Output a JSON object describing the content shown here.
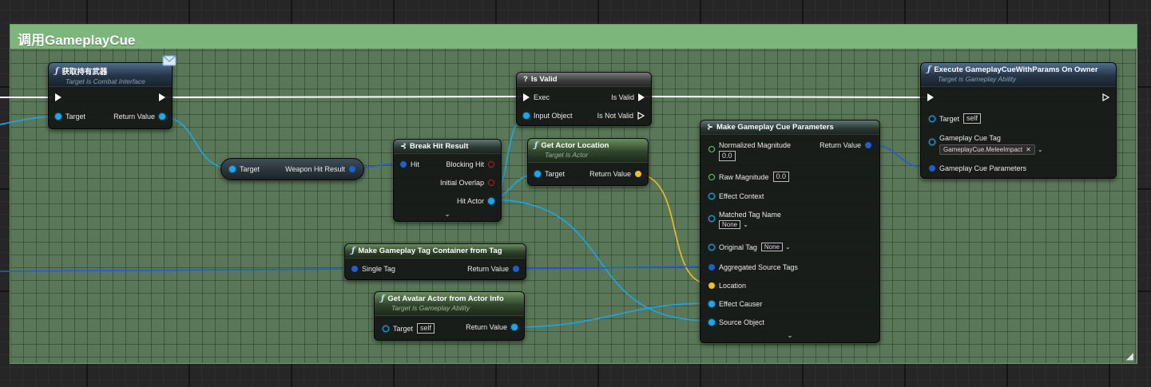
{
  "comment": {
    "title": "调用GameplayCue",
    "resize_glyph": "◢"
  },
  "colors": {
    "exec": "#ffffff",
    "object": "#1aa7ec",
    "struct": "#1d5ed7",
    "vector": "#f0be1f",
    "float": "#5fd35a",
    "bool": "#b31e1e"
  },
  "nodes": {
    "get_weapon": {
      "title": "获取持有武器",
      "subtitle": "Target is Combat Interface",
      "in_target": "Target",
      "out_return": "Return Value",
      "icon": "function-icon",
      "badge": "mail-icon"
    },
    "weapon_hit": {
      "in_target": "Target",
      "out": "Weapon Hit Result"
    },
    "break_hit": {
      "title": "Break Hit Result",
      "in_hit": "Hit",
      "out_blocking": "Blocking Hit",
      "out_overlap": "Initial Overlap",
      "out_actor": "Hit Actor"
    },
    "is_valid": {
      "title": "Is Valid",
      "in_exec": "Exec",
      "in_object": "Input Object",
      "out_valid": "Is Valid",
      "out_not_valid": "Is Not Valid"
    },
    "get_location": {
      "title": "Get Actor Location",
      "subtitle": "Target is Actor",
      "in_target": "Target",
      "out_return": "Return Value"
    },
    "make_container": {
      "title": "Make Gameplay Tag Container from Tag",
      "in_single": "Single Tag",
      "out_return": "Return Value"
    },
    "get_avatar": {
      "title": "Get Avatar Actor from Actor Info",
      "subtitle": "Target is Gameplay Ability",
      "in_target": "Target",
      "target_value": "self",
      "out_return": "Return Value"
    },
    "make_params": {
      "title": "Make Gameplay Cue Parameters",
      "normalized_magnitude": "Normalized Magnitude",
      "normalized_value": "0.0",
      "raw_magnitude": "Raw Magnitude",
      "raw_value": "0.0",
      "effect_context": "Effect Context",
      "matched_tag": "Matched Tag Name",
      "matched_value": "None",
      "original_tag": "Original Tag",
      "original_value": "None",
      "aggregated": "Aggregated Source Tags",
      "location": "Location",
      "effect_causer": "Effect Causer",
      "source_object": "Source Object",
      "out_return": "Return Value"
    },
    "execute_cue": {
      "title": "Execute GameplayCueWithParams On Owner",
      "subtitle": "Target is Gameplay Ability",
      "in_target": "Target",
      "target_value": "self",
      "cue_tag": "Gameplay Cue Tag",
      "cue_tag_value": "GameplayCue.MeleeImpact",
      "clear_glyph": "✕",
      "params": "Gameplay Cue Parameters"
    }
  }
}
